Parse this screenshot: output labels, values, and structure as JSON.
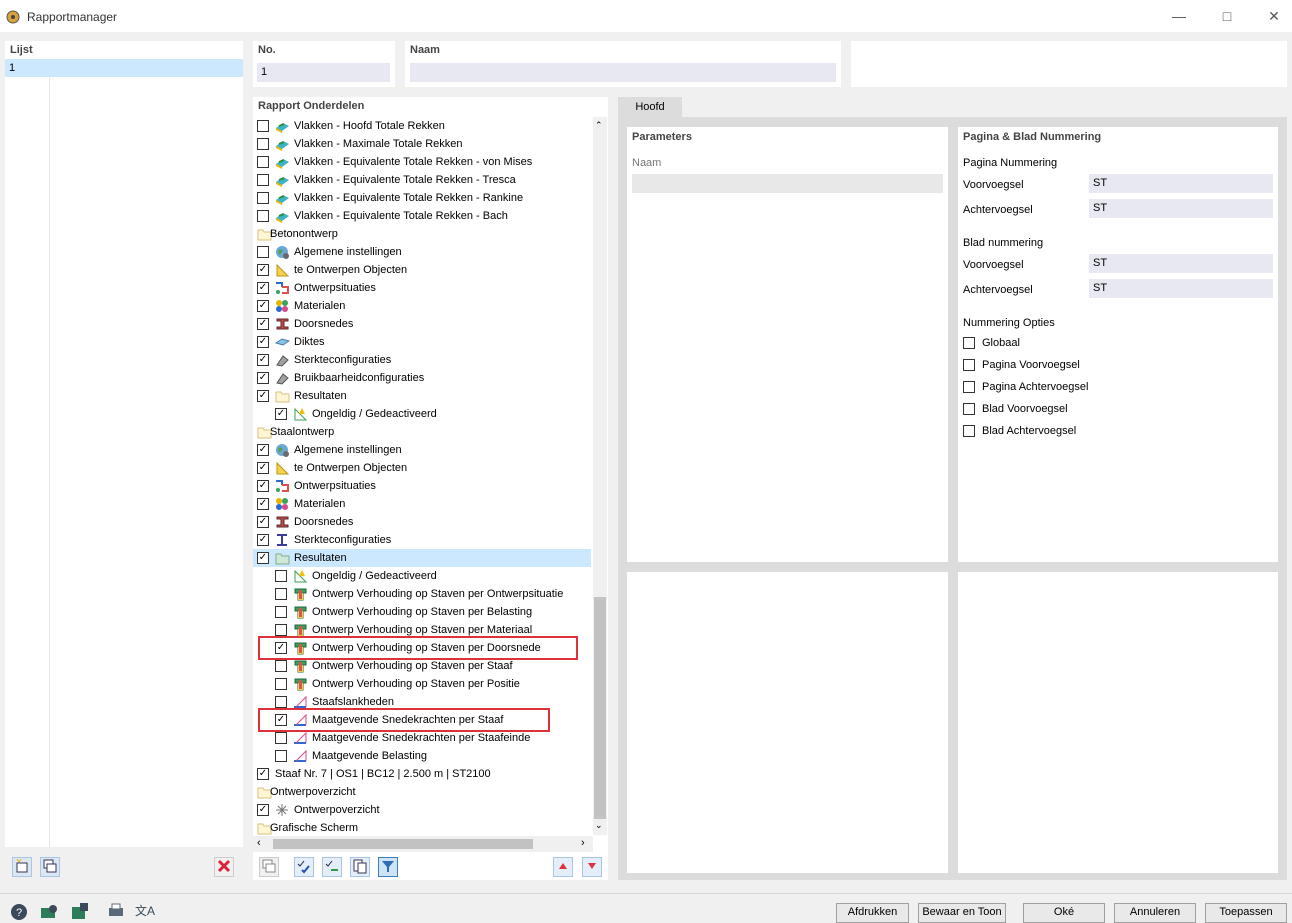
{
  "window": {
    "title": "Rapportmanager"
  },
  "lijst": {
    "header": "Lijst",
    "items": [
      "1"
    ]
  },
  "no": {
    "header": "No.",
    "value": "1"
  },
  "naam": {
    "header": "Naam",
    "value": ""
  },
  "rapport": {
    "header": "Rapport Onderdelen",
    "items": [
      {
        "label": "Vlakken - Hoofd Totale Rekken",
        "checked": false,
        "indent": 0,
        "icon": "surface-icon"
      },
      {
        "label": "Vlakken - Maximale Totale Rekken",
        "checked": false,
        "indent": 0,
        "icon": "surface-icon"
      },
      {
        "label": "Vlakken - Equivalente Totale Rekken - von Mises",
        "checked": false,
        "indent": 0,
        "icon": "surface-icon"
      },
      {
        "label": "Vlakken - Equivalente Totale Rekken - Tresca",
        "checked": false,
        "indent": 0,
        "icon": "surface-icon"
      },
      {
        "label": "Vlakken - Equivalente Totale Rekken - Rankine",
        "checked": false,
        "indent": 0,
        "icon": "surface-icon"
      },
      {
        "label": "Vlakken - Equivalente Totale Rekken - Bach",
        "checked": false,
        "indent": 0,
        "icon": "surface-icon"
      },
      {
        "label": "Betonontwerp",
        "checked": null,
        "indent": 0,
        "icon": "folder-icon"
      },
      {
        "label": "Algemene instellingen",
        "checked": false,
        "indent": 0,
        "icon": "globe-icon"
      },
      {
        "label": "te Ontwerpen Objecten",
        "checked": true,
        "indent": 0,
        "icon": "triangle-icon"
      },
      {
        "label": "Ontwerpsituaties",
        "checked": true,
        "indent": 0,
        "icon": "situations-icon"
      },
      {
        "label": "Materialen",
        "checked": true,
        "indent": 0,
        "icon": "materials-icon"
      },
      {
        "label": "Doorsnedes",
        "checked": true,
        "indent": 0,
        "icon": "section-icon"
      },
      {
        "label": "Diktes",
        "checked": true,
        "indent": 0,
        "icon": "thickness-icon"
      },
      {
        "label": "Sterkteconfiguraties",
        "checked": true,
        "indent": 0,
        "icon": "config-icon"
      },
      {
        "label": "Bruikbaarheidconfiguraties",
        "checked": true,
        "indent": 0,
        "icon": "config-icon"
      },
      {
        "label": "Resultaten",
        "checked": true,
        "indent": 0,
        "icon": "folder-icon"
      },
      {
        "label": "Ongeldig / Gedeactiveerd",
        "checked": true,
        "indent": 1,
        "icon": "warning-icon"
      },
      {
        "label": "Staalontwerp",
        "checked": null,
        "indent": 0,
        "icon": "folder-icon"
      },
      {
        "label": "Algemene instellingen",
        "checked": true,
        "indent": 0,
        "icon": "globe-icon"
      },
      {
        "label": "te Ontwerpen Objecten",
        "checked": true,
        "indent": 0,
        "icon": "triangle-icon"
      },
      {
        "label": "Ontwerpsituaties",
        "checked": true,
        "indent": 0,
        "icon": "situations-icon"
      },
      {
        "label": "Materialen",
        "checked": true,
        "indent": 0,
        "icon": "materials-icon"
      },
      {
        "label": "Doorsnedes",
        "checked": true,
        "indent": 0,
        "icon": "section-icon"
      },
      {
        "label": "Sterkteconfiguraties",
        "checked": true,
        "indent": 0,
        "icon": "steel-config-icon"
      },
      {
        "label": "Resultaten",
        "checked": true,
        "indent": 0,
        "icon": "folder-green-icon",
        "selected": true
      },
      {
        "label": "Ongeldig / Gedeactiveerd",
        "checked": false,
        "indent": 1,
        "icon": "warning-icon"
      },
      {
        "label": "Ontwerp Verhouding op Staven per Ontwerpsituatie",
        "checked": false,
        "indent": 1,
        "icon": "ratio-icon"
      },
      {
        "label": "Ontwerp Verhouding op Staven per Belasting",
        "checked": false,
        "indent": 1,
        "icon": "ratio-icon"
      },
      {
        "label": "Ontwerp Verhouding op Staven per Materiaal",
        "checked": false,
        "indent": 1,
        "icon": "ratio-icon"
      },
      {
        "label": "Ontwerp Verhouding op Staven per Doorsnede",
        "checked": true,
        "indent": 1,
        "icon": "ratio-icon"
      },
      {
        "label": "Ontwerp Verhouding op Staven per Staaf",
        "checked": false,
        "indent": 1,
        "icon": "ratio-icon"
      },
      {
        "label": "Ontwerp Verhouding op Staven per Positie",
        "checked": false,
        "indent": 1,
        "icon": "ratio-icon"
      },
      {
        "label": "Staafslankheden",
        "checked": false,
        "indent": 1,
        "icon": "forces-icon"
      },
      {
        "label": "Maatgevende Snedekrachten per Staaf",
        "checked": true,
        "indent": 1,
        "icon": "forces-icon"
      },
      {
        "label": "Maatgevende Snedekrachten per Staafeinde",
        "checked": false,
        "indent": 1,
        "icon": "forces-icon"
      },
      {
        "label": "Maatgevende Belasting",
        "checked": false,
        "indent": 1,
        "icon": "forces-icon"
      },
      {
        "label": "Staaf Nr. 7 | OS1 | BC12 | 2.500 m | ST2100",
        "checked": true,
        "indent": 0,
        "icon": ""
      },
      {
        "label": "Ontwerpoverzicht",
        "checked": null,
        "indent": 0,
        "icon": "folder-icon"
      },
      {
        "label": "Ontwerpoverzicht",
        "checked": true,
        "indent": 0,
        "icon": "asterisk-icon"
      },
      {
        "label": "Grafische Scherm",
        "checked": null,
        "indent": 0,
        "icon": "folder-icon"
      }
    ]
  },
  "tabs": [
    {
      "label": "Hoofd"
    }
  ],
  "parameters": {
    "header": "Parameters",
    "naam_label": "Naam",
    "naam_value": ""
  },
  "pagina": {
    "header": "Pagina & Blad Nummering",
    "pagina_nummering": "Pagina Nummering",
    "blad_nummering": "Blad nummering",
    "voorvoegsel": "Voorvoegsel",
    "achtervoegsel": "Achtervoegsel",
    "pagina_voor": "ST",
    "pagina_achter": "ST",
    "blad_voor": "ST",
    "blad_achter": "ST",
    "opties_header": "Nummering Opties",
    "opties": [
      {
        "label": "Globaal",
        "checked": false
      },
      {
        "label": "Pagina Voorvoegsel",
        "checked": false
      },
      {
        "label": "Pagina Achtervoegsel",
        "checked": false
      },
      {
        "label": "Blad Voorvoegsel",
        "checked": false
      },
      {
        "label": "Blad Achtervoegsel",
        "checked": false
      }
    ]
  },
  "buttons": {
    "afdrukken": "Afdrukken",
    "bewaar": "Bewaar en Toon",
    "oke": "Oké",
    "annuleren": "Annuleren",
    "toepassen": "Toepassen"
  },
  "colors": {
    "selection": "#cce8ff",
    "highlight": "#e0303a",
    "input_bg": "#e7e8f1"
  }
}
